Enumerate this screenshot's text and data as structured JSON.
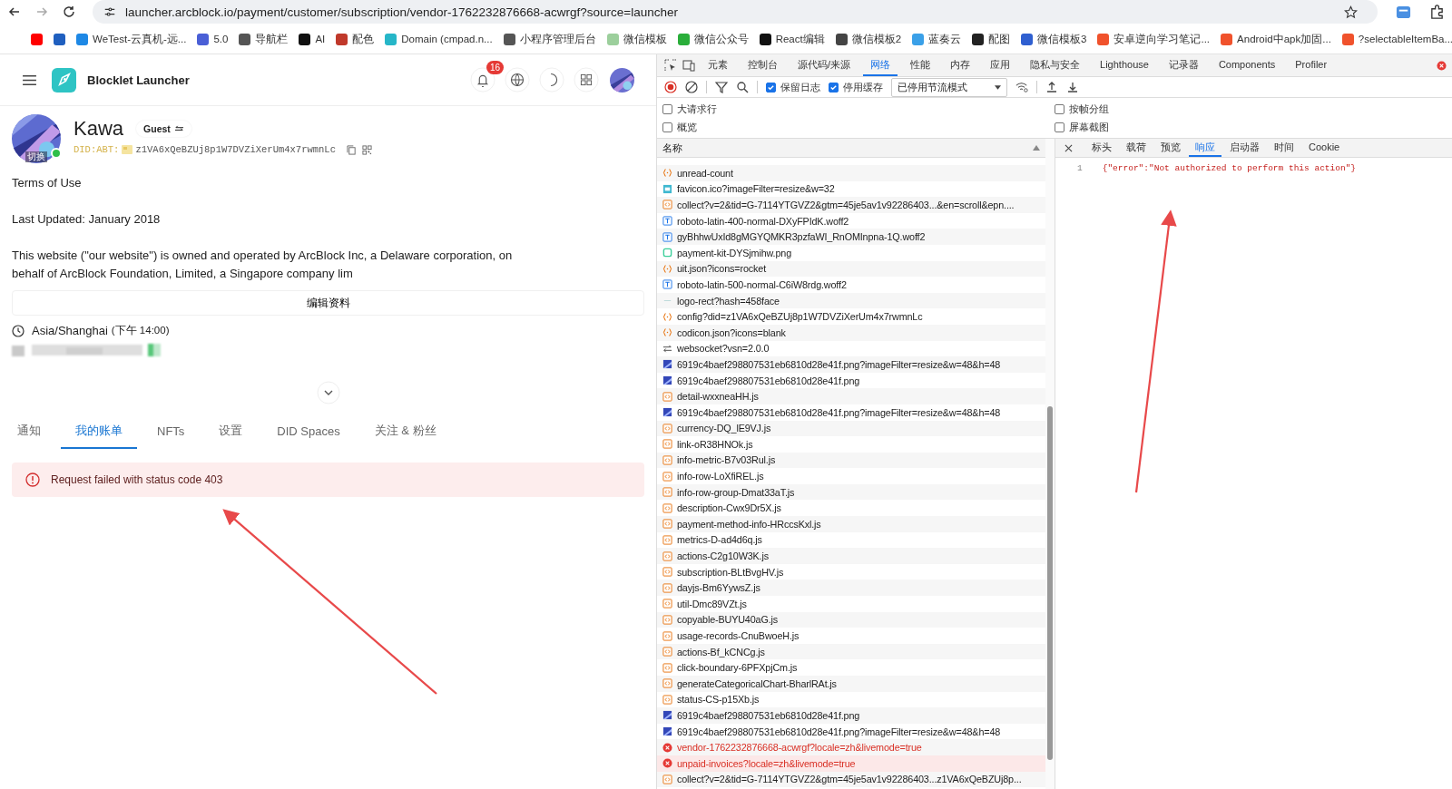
{
  "browser": {
    "url": "launcher.arcblock.io/payment/customer/subscription/vendor-1762232876668-acwrgf?source=launcher",
    "bookmarks": [
      {
        "color": "#ff0000"
      },
      {
        "color": "#1f5fbf"
      },
      {
        "label": "WeTest-云真机-远...",
        "color": "#1e88e5"
      },
      {
        "label": "5.0",
        "color": "#4a5fd6"
      },
      {
        "label": "导航栏",
        "color": "#555555"
      },
      {
        "label": "AI",
        "color": "#111111"
      },
      {
        "label": "配色",
        "color": "#c0392b"
      },
      {
        "label": "Domain (cmpad.n...",
        "color": "#26b6c8"
      },
      {
        "label": "小程序管理后台",
        "color": "#555555"
      },
      {
        "label": "微信模板",
        "color": "#9ccf9c"
      },
      {
        "label": "微信公众号",
        "color": "#2aae3a"
      },
      {
        "label": "React编辑",
        "color": "#111111"
      },
      {
        "label": "微信模板2",
        "color": "#444444"
      },
      {
        "label": "蓝奏云",
        "color": "#3aa0e8"
      },
      {
        "label": "配图",
        "color": "#222222"
      },
      {
        "label": "微信模板3",
        "color": "#2f5fd0"
      },
      {
        "label": "安卓逆向学习笔记...",
        "color": "#f0522c"
      },
      {
        "label": "Android中apk加固...",
        "color": "#f0522c"
      },
      {
        "label": "?selectableItemBa...",
        "color": "#f0522c"
      }
    ]
  },
  "app": {
    "title": "Blocklet Launcher",
    "notification_count": "16",
    "profile": {
      "name": "Kawa",
      "role": "Guest",
      "avatar_label": "切换",
      "online": true,
      "did_prefix": "DID:ABT:",
      "did": "z1VA6xQeBZUj8p1W7DVZiXerUm4x7rwmnLc"
    },
    "paragraphs": [
      "Terms of Use",
      "Last Updated: January 2018",
      "This website (\"our website\") is owned and operated by ArcBlock Inc, a Delaware corporation, on behalf of ArcBlock Foundation, Limited, a Singapore company lim"
    ],
    "edit_button": "编辑资料",
    "timezone": "Asia/Shanghai",
    "local_time": "(下午 14:00)",
    "tabs": [
      {
        "label": "通知",
        "selected": false
      },
      {
        "label": "我的账单",
        "selected": true
      },
      {
        "label": "NFTs",
        "selected": false
      },
      {
        "label": "设置",
        "selected": false
      },
      {
        "label": "DID Spaces",
        "selected": false
      },
      {
        "label": "关注 & 粉丝",
        "selected": false
      }
    ],
    "error": "Request failed with status code 403"
  },
  "devtools": {
    "tabs": [
      {
        "label": "元素",
        "selected": false
      },
      {
        "label": "控制台",
        "selected": false
      },
      {
        "label": "源代码/来源",
        "selected": false
      },
      {
        "label": "网络",
        "selected": true
      },
      {
        "label": "性能",
        "selected": false
      },
      {
        "label": "内存",
        "selected": false
      },
      {
        "label": "应用",
        "selected": false
      },
      {
        "label": "隐私与安全",
        "selected": false
      },
      {
        "label": "Lighthouse",
        "selected": false
      },
      {
        "label": "记录器",
        "selected": false
      },
      {
        "label": "Components",
        "selected": false
      },
      {
        "label": "Profiler",
        "selected": false
      }
    ],
    "toolbar": {
      "preserve_log": {
        "label": "保留日志",
        "checked": true
      },
      "disable_cache": {
        "label": "停用缓存",
        "checked": true
      },
      "throttling": "已停用节流模式"
    },
    "options": [
      {
        "label": "大请求行",
        "checked": false
      },
      {
        "label": "按帧分组",
        "checked": false
      },
      {
        "label": "概览",
        "checked": false
      },
      {
        "label": "屏幕截图",
        "checked": false
      }
    ],
    "name_header": "名称",
    "requests": [
      {
        "name": "unread-count",
        "kind": "fetch",
        "selected": false
      },
      {
        "name": "favicon.ico?imageFilter=resize&w=32",
        "kind": "favicon",
        "selected": false
      },
      {
        "name": "collect?v=2&tid=G-7114YTGVZ2&gtm=45je5av1v92286403...&en=scroll&epn....",
        "kind": "script",
        "selected": false
      },
      {
        "name": "roboto-latin-400-normal-DXyFPIdK.woff2",
        "kind": "font",
        "selected": false
      },
      {
        "name": "gyBhhwUxId8gMGYQMKR3pzfaWI_RnOMInpna-1Q.woff2",
        "kind": "font",
        "selected": false
      },
      {
        "name": "payment-kit-DYSjmihw.png",
        "kind": "png",
        "selected": false
      },
      {
        "name": "uit.json?icons=rocket",
        "kind": "fetch",
        "selected": false
      },
      {
        "name": "roboto-latin-500-normal-C6iW8rdg.woff2",
        "kind": "font",
        "selected": false
      },
      {
        "name": "logo-rect?hash=458face",
        "kind": "line",
        "selected": false
      },
      {
        "name": "config?did=z1VA6xQeBZUj8p1W7DVZiXerUm4x7rwmnLc",
        "kind": "fetch",
        "selected": false
      },
      {
        "name": "codicon.json?icons=blank",
        "kind": "fetch",
        "selected": false
      },
      {
        "name": "websocket?vsn=2.0.0",
        "kind": "socket",
        "selected": false
      },
      {
        "name": "6919c4baef298807531eb6810d28e41f.png?imageFilter=resize&w=48&h=48",
        "kind": "avatar",
        "selected": false
      },
      {
        "name": "6919c4baef298807531eb6810d28e41f.png",
        "kind": "avatar",
        "selected": false
      },
      {
        "name": "detail-wxxneaHH.js",
        "kind": "script",
        "selected": false
      },
      {
        "name": "6919c4baef298807531eb6810d28e41f.png?imageFilter=resize&w=48&h=48",
        "kind": "avatar",
        "selected": false
      },
      {
        "name": "currency-DQ_lE9VJ.js",
        "kind": "script",
        "selected": false
      },
      {
        "name": "link-oR38HNOk.js",
        "kind": "script",
        "selected": false
      },
      {
        "name": "info-metric-B7v03Rul.js",
        "kind": "script",
        "selected": false
      },
      {
        "name": "info-row-LoXfiREL.js",
        "kind": "script",
        "selected": false
      },
      {
        "name": "info-row-group-Dmat33aT.js",
        "kind": "script",
        "selected": false
      },
      {
        "name": "description-Cwx9Dr5X.js",
        "kind": "script",
        "selected": false
      },
      {
        "name": "payment-method-info-HRccsKxl.js",
        "kind": "script",
        "selected": false
      },
      {
        "name": "metrics-D-ad4d6q.js",
        "kind": "script",
        "selected": false
      },
      {
        "name": "actions-C2g10W3K.js",
        "kind": "script",
        "selected": false
      },
      {
        "name": "subscription-BLtBvgHV.js",
        "kind": "script",
        "selected": false
      },
      {
        "name": "dayjs-Bm6YywsZ.js",
        "kind": "script",
        "selected": false
      },
      {
        "name": "util-Dmc89VZt.js",
        "kind": "script",
        "selected": false
      },
      {
        "name": "copyable-BUYU40aG.js",
        "kind": "script",
        "selected": false
      },
      {
        "name": "usage-records-CnuBwoeH.js",
        "kind": "script",
        "selected": false
      },
      {
        "name": "actions-Bf_kCNCg.js",
        "kind": "script",
        "selected": false
      },
      {
        "name": "click-boundary-6PFXpjCm.js",
        "kind": "script",
        "selected": false
      },
      {
        "name": "generateCategoricalChart-BharlRAt.js",
        "kind": "script",
        "selected": false
      },
      {
        "name": "status-CS-p15Xb.js",
        "kind": "script",
        "selected": false
      },
      {
        "name": "6919c4baef298807531eb6810d28e41f.png",
        "kind": "avatar",
        "selected": false
      },
      {
        "name": "6919c4baef298807531eb6810d28e41f.png?imageFilter=resize&w=48&h=48",
        "kind": "avatar",
        "selected": false
      },
      {
        "name": "vendor-1762232876668-acwrgf?locale=zh&livemode=true",
        "kind": "error",
        "selected": false
      },
      {
        "name": "unpaid-invoices?locale=zh&livemode=true",
        "kind": "error",
        "selected": true
      },
      {
        "name": "collect?v=2&tid=G-7114YTGVZ2&gtm=45je5av1v92286403...z1VA6xQeBZUj8p...",
        "kind": "script",
        "selected": false
      }
    ],
    "detail_tabs": [
      {
        "label": "标头",
        "selected": false
      },
      {
        "label": "载荷",
        "selected": false
      },
      {
        "label": "预览",
        "selected": false
      },
      {
        "label": "响应",
        "selected": true
      },
      {
        "label": "启动器",
        "selected": false
      },
      {
        "label": "时间",
        "selected": false
      },
      {
        "label": "Cookie",
        "selected": false
      }
    ],
    "response": [
      {
        "line": "1",
        "text": "{\"error\":\"Not authorized to perform this action\"}"
      }
    ]
  }
}
